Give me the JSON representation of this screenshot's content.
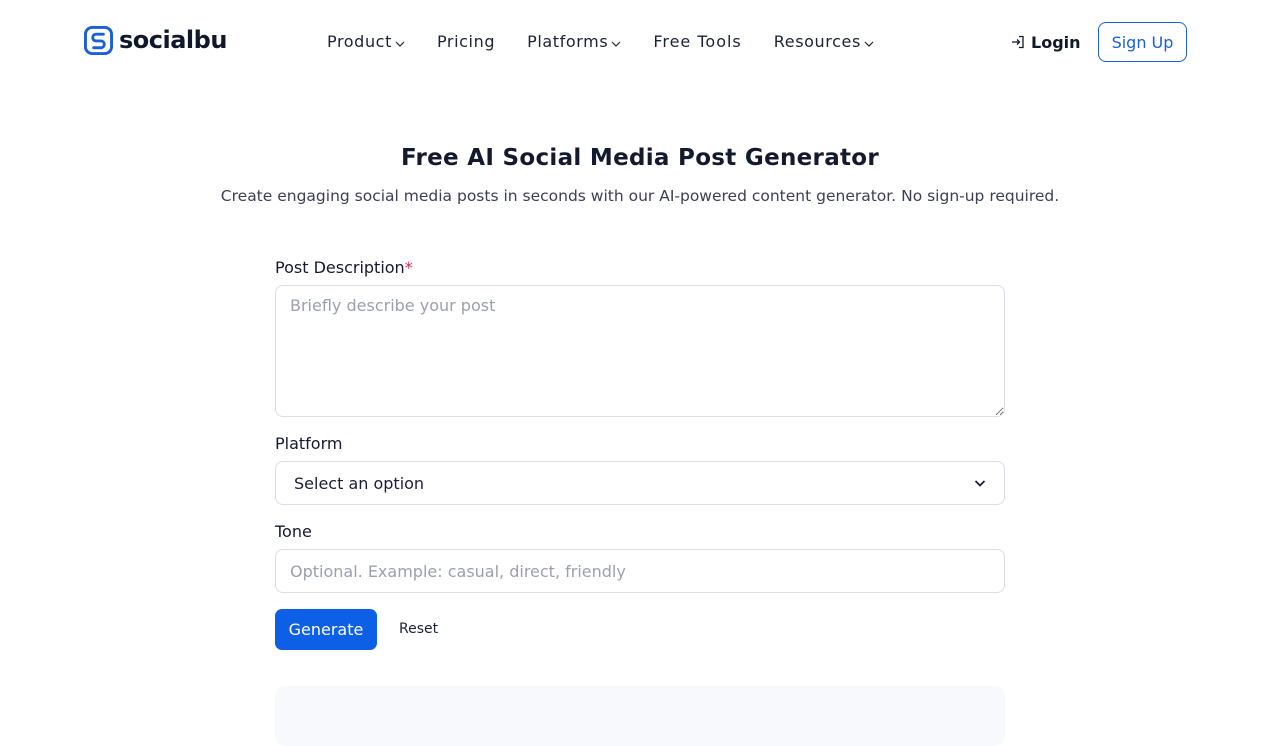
{
  "header": {
    "logo_text": "socialbu",
    "nav": {
      "product": "Product",
      "pricing": "Pricing",
      "platforms": "Platforms",
      "free_tools": "Free Tools",
      "resources": "Resources"
    },
    "login_label": "Login",
    "signup_label": "Sign Up"
  },
  "hero": {
    "title": "Free AI Social Media Post Generator",
    "subtitle": "Create engaging social media posts in seconds with our AI-powered content generator. No sign-up required."
  },
  "form": {
    "description": {
      "label": "Post Description",
      "required_marker": "*",
      "placeholder": "Briefly describe your post",
      "value": ""
    },
    "platform": {
      "label": "Platform",
      "selected": "Select an option"
    },
    "tone": {
      "label": "Tone",
      "placeholder": "Optional. Example: casual, direct, friendly",
      "value": ""
    },
    "generate_label": "Generate",
    "reset_label": "Reset"
  },
  "colors": {
    "primary": "#0d5fe6",
    "signup_border": "#1a5fd6",
    "required": "#d2265a",
    "text_dark": "#131a2e",
    "border": "#d9dde5"
  },
  "icons": {
    "logo": "socialbu-logo-icon",
    "login": "login-arrow-icon",
    "dropdown": "chevron-down-icon"
  }
}
